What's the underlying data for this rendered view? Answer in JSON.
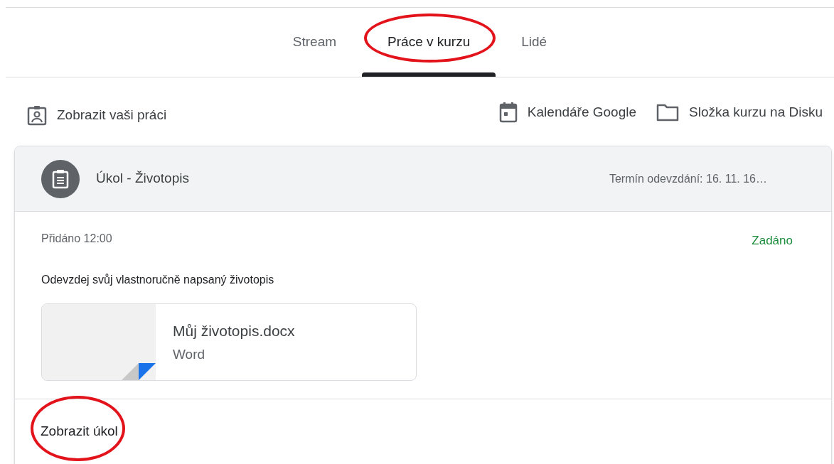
{
  "tabs": [
    {
      "label": "Stream",
      "selected": false,
      "circled": false
    },
    {
      "label": "Práce v kurzu",
      "selected": true,
      "circled": true
    },
    {
      "label": "Lidé",
      "selected": false,
      "circled": false
    }
  ],
  "toolbar": {
    "left": {
      "label": "Zobrazit vaši práci"
    },
    "right": [
      {
        "label": "Kalendáře Google",
        "kind": "calendar"
      },
      {
        "label": "Složka kurzu na Disku",
        "kind": "folder"
      }
    ]
  },
  "assignment": {
    "title": "Úkol - Životopis",
    "due": "Termín odevzdání: 16. 11. 16…",
    "posted": "Přidáno 12:00",
    "status": "Zadáno",
    "description": "Odevzdej svůj vlastnoručně napsaný životopis",
    "attachment": {
      "name": "Můj životopis.docx",
      "type": "Word"
    },
    "footer_link": {
      "label": "Zobrazit úkol",
      "circled": true
    }
  }
}
